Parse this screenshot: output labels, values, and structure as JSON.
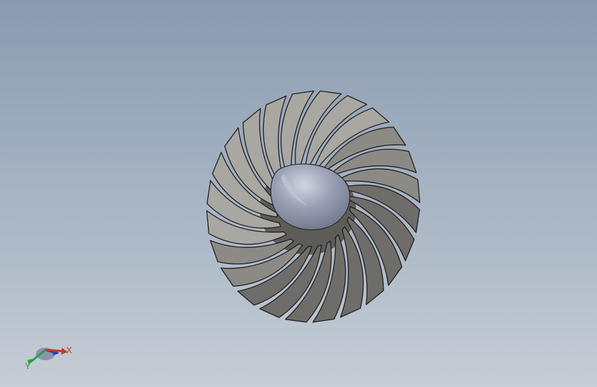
{
  "viewport": {
    "background_top": "#8a9bb0",
    "background_bottom": "#c6cdd6"
  },
  "model": {
    "blade_count": 24,
    "blade_fill": "#8c8a85",
    "blade_shade": "#6f6d69",
    "blade_highlight": "#a9a7a2",
    "blade_edge": "#1e1e1e",
    "spinner_fill": "#8d93a8",
    "spinner_highlight": "#c3c8d6"
  },
  "triad": {
    "x_label": "X",
    "y_label": "Y",
    "x_color": "#c0392b",
    "y_color": "#27a33a",
    "z_color": "#2a3fa8"
  }
}
